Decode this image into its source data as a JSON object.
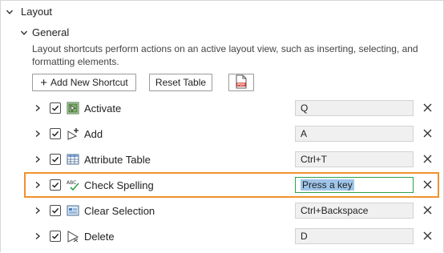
{
  "section": {
    "label": "Layout"
  },
  "subsection": {
    "label": "General"
  },
  "description": "Layout shortcuts perform actions on an active layout view, such as inserting, selecting, and formatting elements.",
  "toolbar": {
    "add_label": "Add New Shortcut",
    "reset_label": "Reset Table",
    "pdf_icon": "pdf-export-icon"
  },
  "shortcuts": [
    {
      "label": "Activate",
      "key": "Q",
      "icon": "activate-icon",
      "checked": true
    },
    {
      "label": "Add",
      "key": "A",
      "icon": "add-element-icon",
      "checked": true
    },
    {
      "label": "Attribute Table",
      "key": "Ctrl+T",
      "icon": "attribute-table-icon",
      "checked": true
    },
    {
      "label": "Check Spelling",
      "key": "Press a key",
      "icon": "spell-check-icon",
      "checked": true,
      "editing": true
    },
    {
      "label": "Clear Selection",
      "key": "Ctrl+Backspace",
      "icon": "clear-selection-icon",
      "checked": true
    },
    {
      "label": "Delete",
      "key": "D",
      "icon": "delete-element-icon",
      "checked": true
    }
  ],
  "spell_icon_text": "ABC",
  "colors": {
    "highlight": "#f0922c",
    "active_field_border": "#2fa04a",
    "selection": "#9ec5ea"
  }
}
